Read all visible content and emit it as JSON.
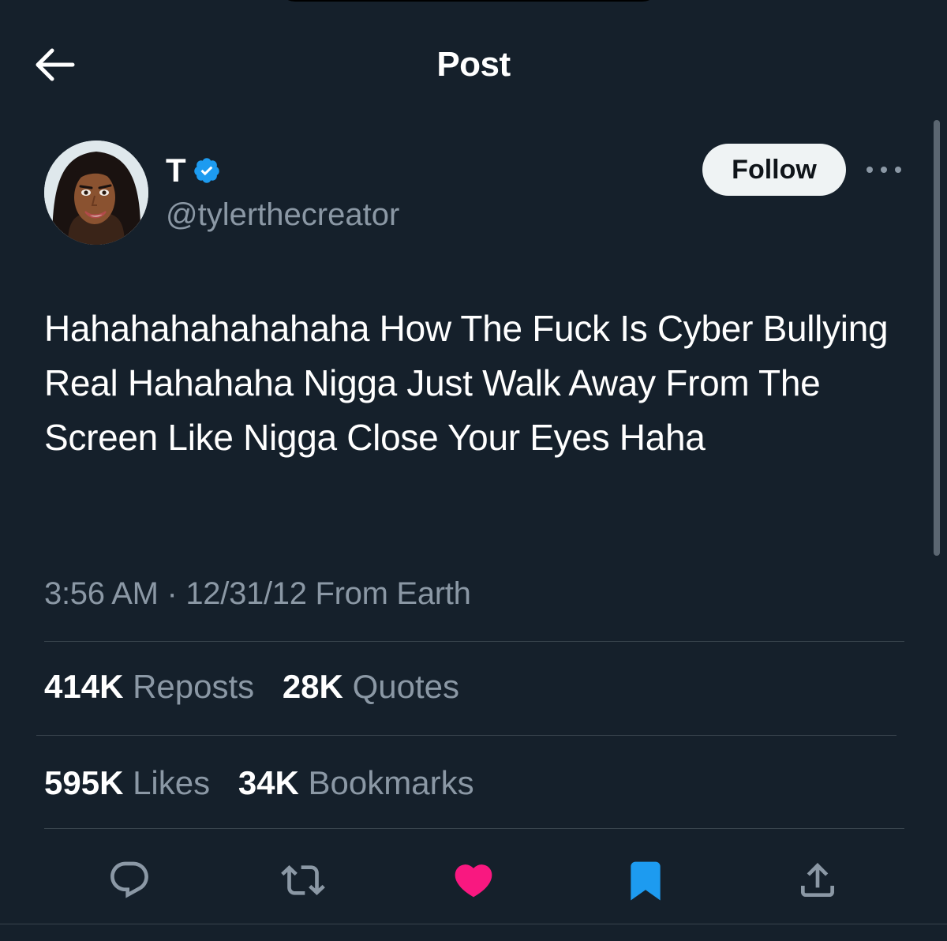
{
  "header": {
    "title": "Post",
    "back_icon": "arrow-left-icon"
  },
  "author": {
    "display_name": "T",
    "handle": "@tylerthecreator",
    "verified_icon": "verified-badge-icon",
    "verified_color": "#1d9bf0",
    "follow_label": "Follow",
    "more_icon": "more-horizontal-icon"
  },
  "post": {
    "text": "Hahahahahahahaha How The Fuck Is Cyber Bullying Real Hahahaha Nigga Just Walk Away From The Screen Like Nigga Close Your Eyes Haha",
    "time": "3:56 AM",
    "separator": "·",
    "date": "12/31/12",
    "source": "From Earth"
  },
  "stats": {
    "reposts": {
      "count": "414K",
      "label": "Reposts"
    },
    "quotes": {
      "count": "28K",
      "label": "Quotes"
    },
    "likes": {
      "count": "595K",
      "label": "Likes"
    },
    "bookmarks": {
      "count": "34K",
      "label": "Bookmarks"
    }
  },
  "actions": [
    {
      "name": "reply",
      "icon": "reply-icon",
      "active": false
    },
    {
      "name": "repost",
      "icon": "repost-icon",
      "active": false
    },
    {
      "name": "like",
      "icon": "heart-icon",
      "active": true
    },
    {
      "name": "bookmark",
      "icon": "bookmark-icon",
      "active": true
    },
    {
      "name": "share",
      "icon": "share-icon",
      "active": false
    }
  ],
  "colors": {
    "background": "#15202b",
    "text_primary": "#ffffff",
    "text_secondary": "#8b98a5",
    "divider": "#38444d",
    "like_active": "#f91880",
    "bookmark_active": "#1d9bf0"
  }
}
